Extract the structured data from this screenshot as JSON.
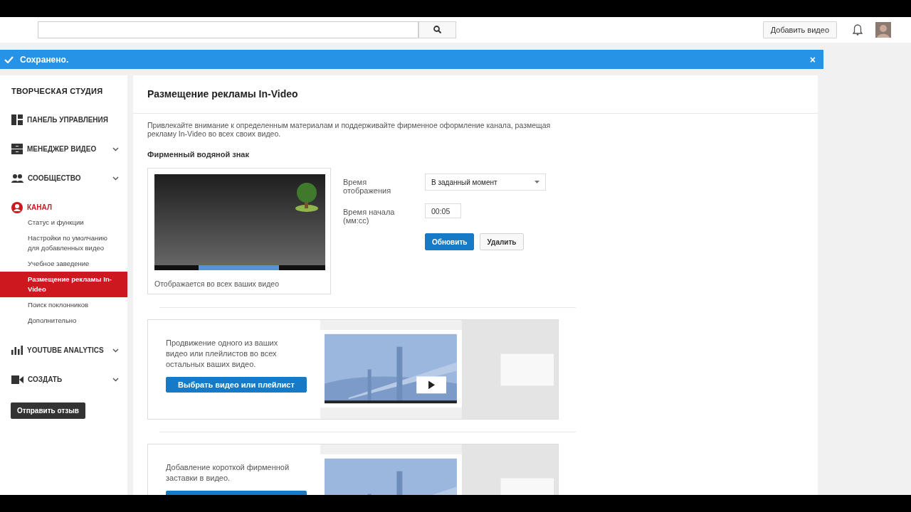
{
  "header": {
    "upload_button": "Добавить видео"
  },
  "banner": {
    "message": "Сохранено.",
    "close": "×"
  },
  "sidebar": {
    "title": "ТВОРЧЕСКАЯ СТУДИЯ",
    "items": [
      {
        "label": "ПАНЕЛЬ УПРАВЛЕНИЯ",
        "selected": false,
        "expandable": false
      },
      {
        "label": "МЕНЕДЖЕР ВИДЕО",
        "selected": false,
        "expandable": true
      },
      {
        "label": "СООБЩЕСТВО",
        "selected": false,
        "expandable": true
      },
      {
        "label": "КАНАЛ",
        "selected": true,
        "expandable": false,
        "children": [
          {
            "label": "Статус и функции",
            "selected": false
          },
          {
            "label": "Настройки по умолчанию для добавленных видео",
            "selected": false
          },
          {
            "label": "Учебное заведение",
            "selected": false
          },
          {
            "label": "Размещение рекламы In-Video",
            "selected": true
          },
          {
            "label": "Поиск поклонников",
            "selected": false
          },
          {
            "label": "Дополнительно",
            "selected": false
          }
        ]
      },
      {
        "label": "YOUTUBE ANALYTICS",
        "selected": false,
        "expandable": true
      },
      {
        "label": "СОЗДАТЬ",
        "selected": false,
        "expandable": true
      }
    ],
    "feedback_button": "Отправить отзыв"
  },
  "main": {
    "title": "Размещение рекламы In-Video",
    "description": "Привлекайте внимание к определенным материалам и поддерживайте фирменное оформление канала, размещая рекламу In-Video во всех своих видео.",
    "watermark": {
      "heading": "Фирменный водяной знак",
      "caption": "Отображается во всех ваших видео",
      "display_time_label": "Время отображения",
      "display_time_value": "В заданный момент",
      "start_time_label": "Время начала (мм:сс)",
      "start_time_value": "00:05",
      "buttons": [
        {
          "label": "Обновить",
          "kind": "primary"
        },
        {
          "label": "Удалить",
          "kind": "secondary"
        }
      ]
    },
    "promos": [
      {
        "text": "Продвижение одного из ваших видео или плейлистов во всех остальных ваших видео.",
        "button": {
          "label": "Выбрать видео или плейлист",
          "kind": "primary"
        }
      },
      {
        "text": "Добавление короткой фирменной заставки в видео.",
        "button": {
          "kind": "primary"
        }
      }
    ]
  }
}
